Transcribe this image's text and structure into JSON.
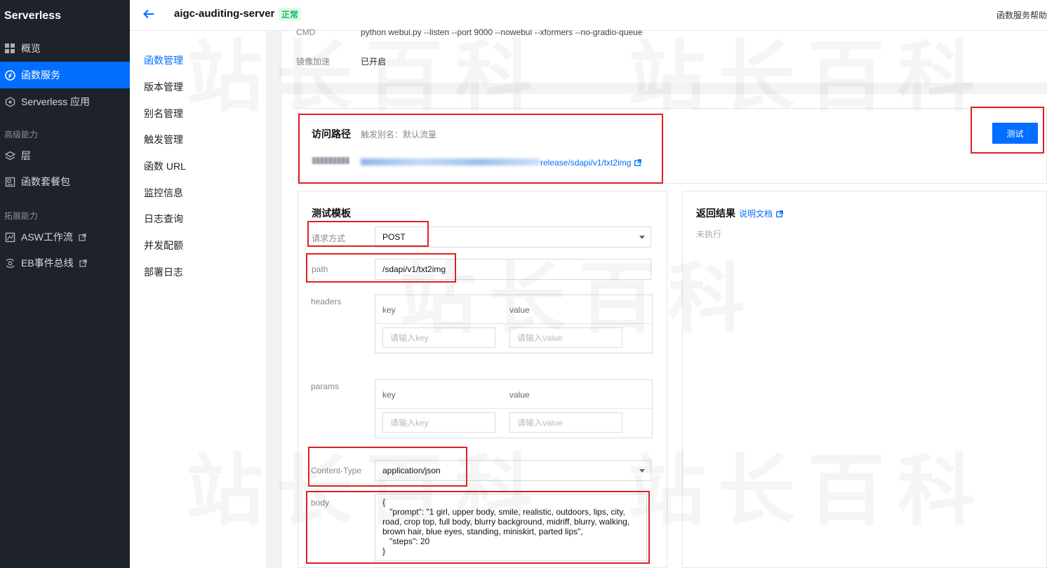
{
  "sidebar": {
    "brand": "Serverless",
    "items": [
      {
        "label": "概览",
        "icon": "grid-icon"
      },
      {
        "label": "函数服务",
        "icon": "function-icon",
        "active": true
      },
      {
        "label": "Serverless 应用",
        "icon": "app-icon"
      }
    ],
    "group_advanced": "高级能力",
    "advanced_items": [
      {
        "label": "层",
        "icon": "layers-icon"
      },
      {
        "label": "函数套餐包",
        "icon": "package-icon"
      }
    ],
    "group_extend": "拓展能力",
    "extend_items": [
      {
        "label": "ASW工作流",
        "icon": "workflow-icon"
      },
      {
        "label": "EB事件总线",
        "icon": "eventbus-icon"
      }
    ]
  },
  "header": {
    "title": "aigc-auditing-server",
    "status": "正常",
    "help": "函数服务帮助"
  },
  "subnav": {
    "items": [
      "函数管理",
      "版本管理",
      "别名管理",
      "触发管理",
      "函数 URL",
      "监控信息",
      "日志查询",
      "并发配额",
      "部署日志"
    ]
  },
  "config": {
    "cmd_label": "CMD",
    "cmd_value": "python webui.py --listen --port 9000 --nowebui --xformers --no-gradio-queue",
    "mirror_label": "镜像加速",
    "mirror_value": "已开启"
  },
  "access": {
    "title": "访问路径",
    "alias": "触发别名：默认流量",
    "url_suffix": "release/sdapi/v1/txt2img"
  },
  "test_button": "测试",
  "template": {
    "title": "测试模板",
    "method_label": "请求方式",
    "method_value": "POST",
    "path_label": "path",
    "path_value": "/sdapi/v1/txt2img",
    "headers_label": "headers",
    "params_label": "params",
    "key_header": "key",
    "value_header": "value",
    "key_placeholder": "请输入key",
    "value_placeholder": "请输入value",
    "content_type_label": "Content-Type",
    "content_type_value": "application/json",
    "body_label": "body",
    "body_value": "{\n   \"prompt\": \"1 girl, upper body, smile, realistic, outdoors, lips, city, road, crop top, full body, blurry background, midriff, blurry, walking, brown hair, blue eyes, standing, miniskirt, parted lips\",\n   \"steps\": 20\n}"
  },
  "result": {
    "title": "返回结果",
    "doc_link": "说明文档",
    "status": "未执行"
  },
  "watermark": "站长百科",
  "colors": {
    "accent": "#006eff",
    "highlight": "#e02020",
    "status_ok": "#0abf5b"
  }
}
